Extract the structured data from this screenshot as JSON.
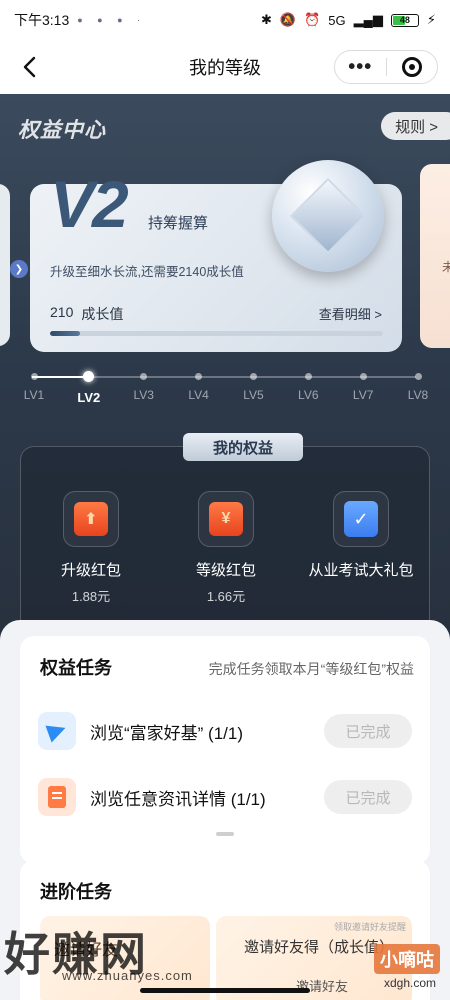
{
  "status_bar": {
    "time": "下午3:13",
    "network": "5G",
    "battery": "48"
  },
  "nav": {
    "title": "我的等级",
    "more_label": "•••"
  },
  "hero": {
    "title": "权益中心",
    "rules_label": "规则 >",
    "right_card_text": "未",
    "level_card": {
      "level": "V2",
      "level_name": "持筹握算",
      "upgrade_tip": "升级至细水长流,还需要2140成长值",
      "growth_value": "210",
      "growth_label": "成长值",
      "view_detail": "查看明细 >",
      "progress_fraction": 0.09
    },
    "levels": [
      "LV1",
      "LV2",
      "LV3",
      "LV4",
      "LV5",
      "LV6",
      "LV7",
      "LV8"
    ],
    "active_level_index": 1
  },
  "rights": {
    "title": "我的权益",
    "items": [
      {
        "name": "升级红包",
        "value": "1.88元",
        "icon": "upgrade-redpacket-icon"
      },
      {
        "name": "等级红包",
        "value": "1.66元",
        "icon": "level-redpacket-icon"
      },
      {
        "name": "从业考试大礼包",
        "value": "",
        "icon": "exam-gift-icon"
      }
    ]
  },
  "tasks": {
    "title": "权益任务",
    "subtitle": "完成任务领取本月“等级红包”权益",
    "items": [
      {
        "text": "浏览“富家好基” (1/1)",
        "status": "已完成",
        "icon": "paper-plane-icon"
      },
      {
        "text": "浏览任意资讯详情 (1/1)",
        "status": "已完成",
        "icon": "document-icon"
      }
    ]
  },
  "advanced": {
    "title": "进阶任务",
    "left_text": "邀请好友",
    "right_text": "邀请好友得（成长值）",
    "right_sub": "邀请好友",
    "right_badge": "领取邀请好友提醒"
  },
  "watermark": {
    "text": "好赚网",
    "url": "www.zhuanyes.com",
    "brand2": "小嘀咕",
    "url2": "xdgh.com"
  },
  "colors": {
    "hero_bg": "#2d3a4b",
    "accent_red": "#e8431e",
    "accent_blue": "#3b7df0"
  }
}
